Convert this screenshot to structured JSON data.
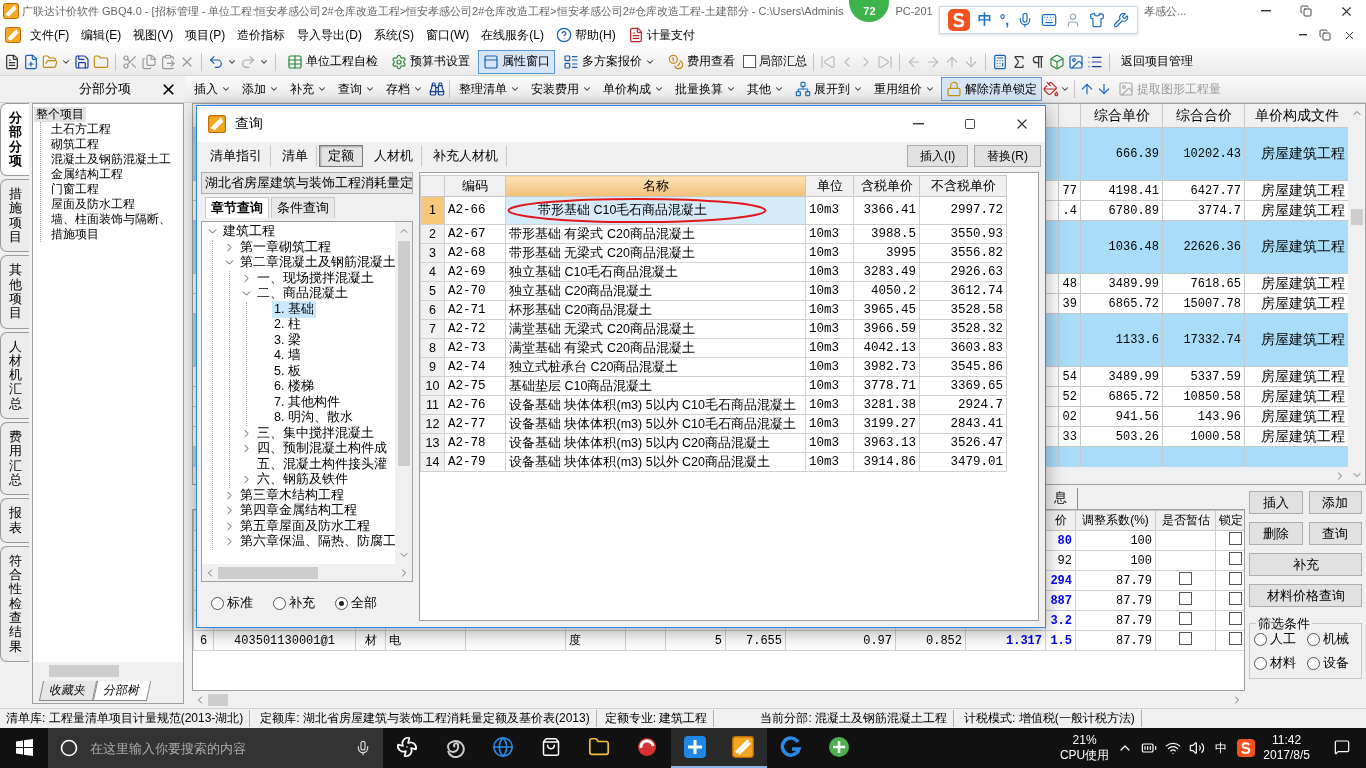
{
  "window": {
    "title": "广联达计价软件 GBQ4.0 - [招标管理 - 单位工程:恒安孝感公司2#仓库改造工程>恒安孝感公司2#仓库改造工程>恒安孝感公司2#仓库改造工程-土建部分 - C:\\Users\\Adminis",
    "badge": "72",
    "title_tail": "PC-201",
    "title_end": "孝感公..."
  },
  "ime": {
    "mode": "中",
    "punctuation": "°,"
  },
  "menu": [
    {
      "label": "文件(F)",
      "kind": "text"
    },
    {
      "label": "编辑(E)",
      "kind": "text"
    },
    {
      "label": "视图(V)",
      "kind": "text"
    },
    {
      "label": "项目(P)",
      "kind": "text"
    },
    {
      "label": "造价指标",
      "kind": "text"
    },
    {
      "label": "导入导出(D)",
      "kind": "text"
    },
    {
      "label": "系统(S)",
      "kind": "text"
    },
    {
      "label": "窗口(W)",
      "kind": "text"
    },
    {
      "label": "在线服务(L)",
      "kind": "text"
    },
    {
      "label": "帮助(H)",
      "kind": "help"
    },
    {
      "label": "计量支付",
      "kind": "pay"
    }
  ],
  "toolbar": {
    "tools": [
      {
        "label": "单位工程自检",
        "pressed": false,
        "menu": false
      },
      {
        "label": "预算书设置",
        "pressed": false,
        "menu": false
      },
      {
        "label": "属性窗口",
        "pressed": true,
        "menu": false
      },
      {
        "label": "多方案报价",
        "pressed": false,
        "menu": true
      },
      {
        "label": "费用查看",
        "pressed": false,
        "menu": false
      }
    ],
    "summary": {
      "label": "局部汇总",
      "checked": false
    },
    "back": "返回项目管理"
  },
  "panel": {
    "title": "分部分项"
  },
  "edit_toolbar": [
    [
      {
        "label": "插入",
        "menu": true,
        "kind": "text",
        "pressed": false,
        "disabled": false
      },
      {
        "label": "添加",
        "menu": true,
        "kind": "text",
        "pressed": false,
        "disabled": false
      },
      {
        "label": "补充",
        "menu": true,
        "kind": "text",
        "pressed": false,
        "disabled": false
      },
      {
        "label": "查询",
        "menu": true,
        "kind": "text",
        "pressed": false,
        "disabled": false
      },
      {
        "label": "存档",
        "menu": true,
        "kind": "text",
        "pressed": false,
        "disabled": false
      }
    ],
    [
      {
        "label": "整理清单",
        "menu": true,
        "kind": "text",
        "pressed": false,
        "disabled": false
      },
      {
        "label": "安装费用",
        "menu": true,
        "kind": "text",
        "pressed": false,
        "disabled": false
      },
      {
        "label": "单价构成",
        "menu": true,
        "kind": "text",
        "pressed": false,
        "disabled": false
      },
      {
        "label": "批量换算",
        "menu": true,
        "kind": "text",
        "pressed": false,
        "disabled": false
      },
      {
        "label": "其他",
        "menu": true,
        "kind": "text",
        "pressed": false,
        "disabled": false
      },
      {
        "label": "展开到",
        "menu": true,
        "kind": "expand",
        "pressed": false,
        "disabled": false
      },
      {
        "label": "重用组价",
        "menu": true,
        "kind": "text",
        "pressed": false,
        "disabled": false
      },
      {
        "label": "解除清单锁定",
        "menu": false,
        "kind": "lock",
        "pressed": true,
        "disabled": false
      }
    ],
    [
      {
        "label": "提取图形工程量",
        "menu": false,
        "kind": "extract",
        "pressed": false,
        "disabled": true
      }
    ]
  ],
  "side_tabs": [
    {
      "label": "分部分项",
      "selected": true
    },
    {
      "label": "措施项目",
      "selected": false
    },
    {
      "label": "其他项目",
      "selected": false
    },
    {
      "label": "人材机汇总",
      "selected": false
    },
    {
      "label": "费用汇总",
      "selected": false
    },
    {
      "label": "报表",
      "selected": false
    },
    {
      "label": "符合性检查结果",
      "selected": false
    }
  ],
  "project_tree": {
    "label": "整个项目",
    "selected": true,
    "children": [
      {
        "label": "土石方工程",
        "selected": false
      },
      {
        "label": "砌筑工程",
        "selected": false
      },
      {
        "label": "混凝土及钢筋混凝土工",
        "selected": false
      },
      {
        "label": "金属结构工程",
        "selected": false
      },
      {
        "label": "门窗工程",
        "selected": false
      },
      {
        "label": "屋面及防水工程",
        "selected": false
      },
      {
        "label": "墙、柱面装饰与隔断、",
        "selected": false
      },
      {
        "label": "措施项目",
        "selected": false
      }
    ]
  },
  "tree_tabs": [
    {
      "label": "收藏夹",
      "selected": false
    },
    {
      "label": "分部树",
      "selected": true
    }
  ],
  "main_grid": {
    "columns": [
      "综合单价",
      "综合合价",
      "单价构成文件"
    ],
    "rows": [
      {
        "kind": "group",
        "unit_price": "666.39",
        "total": "10202.43",
        "file": "房屋建筑工程"
      },
      {
        "kind": "item",
        "partial": "77",
        "unit_price": "4198.41",
        "total": "6427.77",
        "file": "房屋建筑工程"
      },
      {
        "kind": "item",
        "partial": ".4",
        "unit_price": "6780.89",
        "total": "3774.7",
        "file": "房屋建筑工程"
      },
      {
        "kind": "group",
        "unit_price": "1036.48",
        "total": "22626.36",
        "file": "房屋建筑工程"
      },
      {
        "kind": "item",
        "partial": "48",
        "unit_price": "3489.99",
        "total": "7618.65",
        "file": "房屋建筑工程"
      },
      {
        "kind": "item",
        "partial": "39",
        "unit_price": "6865.72",
        "total": "15007.78",
        "file": "房屋建筑工程"
      },
      {
        "kind": "group",
        "unit_price": "1133.6",
        "total": "17332.74",
        "file": "房屋建筑工程"
      },
      {
        "kind": "item",
        "partial": "54",
        "unit_price": "3489.99",
        "total": "5337.59",
        "file": "房屋建筑工程"
      },
      {
        "kind": "item",
        "partial": "52",
        "unit_price": "6865.72",
        "total": "10850.58",
        "file": "房屋建筑工程"
      },
      {
        "kind": "item",
        "partial": "02",
        "unit_price": "941.56",
        "total": "143.96",
        "file": "房屋建筑工程"
      },
      {
        "kind": "item",
        "partial": "33",
        "unit_price": "503.26",
        "total": "1000.58",
        "file": "房屋建筑工程"
      },
      {
        "kind": "group"
      }
    ]
  },
  "lower": {
    "tab": "息",
    "columns": [
      "价",
      "调整系数(%)",
      "是否暂估",
      "锁定"
    ],
    "rows": [
      {
        "price": "80",
        "changed": true,
        "ratio": "100",
        "locked": false
      },
      {
        "price": "92",
        "changed": false,
        "ratio": "100",
        "locked": false
      },
      {
        "price": "294",
        "changed": true,
        "ratio": "87.79",
        "estimate": false,
        "locked": false
      },
      {
        "price": "887",
        "changed": true,
        "ratio": "87.79",
        "estimate": false,
        "locked": false
      },
      {
        "price": "3.2",
        "changed": true,
        "ratio": "87.79",
        "estimate": false,
        "locked": false
      },
      {
        "no": "6",
        "code": "403501130001@1",
        "type": "材",
        "name": "电",
        "unit": "度",
        "quantity": "5",
        "column_9": "7.655",
        "column_10": "0.97",
        "column_11": "0.852",
        "column_12": "1.317",
        "price": "1.5",
        "changed": true,
        "ratio": "87.79",
        "estimate": false,
        "locked": false
      }
    ]
  },
  "side_buttons": [
    {
      "label": "插入",
      "wide": false
    },
    {
      "label": "添加",
      "wide": false
    },
    {
      "label": "删除",
      "wide": false
    },
    {
      "label": "查询",
      "wide": false
    },
    {
      "label": "补充",
      "wide": true
    },
    {
      "label": "材料价格查询",
      "wide": true
    }
  ],
  "filter": {
    "title": "筛选条件",
    "options": [
      {
        "label": "人工",
        "selected": false
      },
      {
        "label": "机械",
        "selected": false
      },
      {
        "label": "材料",
        "selected": false
      },
      {
        "label": "设备",
        "selected": false
      }
    ]
  },
  "status_bar": [
    "清单库: 工程量清单项目计量规范(2013-湖北)",
    "定额库: 湖北省房屋建筑与装饰工程消耗量定额及基价表(2013)",
    "定额专业: 建筑工程",
    "当前分部: 混凝土及钢筋混凝土工程",
    "计税模式: 增值税(一般计税方法)"
  ],
  "taskbar": {
    "placeholder": "在这里输入你要搜索的内容",
    "cpu": "21%",
    "cpu_label": "CPU使用",
    "ime": "中",
    "time": "11:42",
    "date": "2017/8/5"
  },
  "dialog": {
    "title": "查询",
    "tabs": [
      {
        "label": "清单指引",
        "selected": false
      },
      {
        "label": "清单",
        "selected": false
      },
      {
        "label": "定额",
        "selected": true
      },
      {
        "label": "人材机",
        "selected": false
      },
      {
        "label": "补充人材机",
        "selected": false
      }
    ],
    "actions": [
      "插入(I)",
      "替换(R)"
    ],
    "library": "湖北省房屋建筑与装饰工程消耗量定",
    "search_tabs": [
      {
        "label": "章节查询",
        "selected": true
      },
      {
        "label": "条件查询",
        "selected": false
      }
    ],
    "tree": [
      {
        "label": "建筑工程",
        "expanded": true,
        "selected": false,
        "children": [
          {
            "label": "第一章砌筑工程",
            "expanded": false,
            "selected": false
          },
          {
            "label": "第二章混凝土及钢筋混凝土",
            "expanded": true,
            "selected": false,
            "children": [
              {
                "label": "一、现场搅拌混凝土",
                "expanded": false,
                "selected": false
              },
              {
                "label": "二、商品混凝土",
                "expanded": true,
                "selected": false,
                "children": [
                  {
                    "label": "1. 基础",
                    "selected": true
                  },
                  {
                    "label": "2. 柱",
                    "selected": false
                  },
                  {
                    "label": "3. 梁",
                    "selected": false
                  },
                  {
                    "label": "4. 墙",
                    "selected": false
                  },
                  {
                    "label": "5. 板",
                    "selected": false
                  },
                  {
                    "label": "6. 楼梯",
                    "selected": false
                  },
                  {
                    "label": "7. 其他构件",
                    "selected": false
                  },
                  {
                    "label": "8. 明沟、散水",
                    "selected": false
                  }
                ]
              },
              {
                "label": "三、集中搅拌混凝土",
                "expanded": false,
                "selected": false
              },
              {
                "label": "四、预制混凝土构件成",
                "expanded": false,
                "selected": false
              },
              {
                "label": "五、混凝土构件接头灌",
                "selected": false
              },
              {
                "label": "六、钢筋及铁件",
                "expanded": false,
                "selected": false
              }
            ]
          },
          {
            "label": "第三章木结构工程",
            "expanded": false,
            "selected": false
          },
          {
            "label": "第四章金属结构工程",
            "expanded": false,
            "selected": false
          },
          {
            "label": "第五章屋面及防水工程",
            "expanded": false,
            "selected": false
          },
          {
            "label": "第六章保温、隔热、防腐工",
            "expanded": false,
            "selected": false
          }
        ]
      }
    ],
    "scope": [
      {
        "label": "标准",
        "selected": false
      },
      {
        "label": "补充",
        "selected": false
      },
      {
        "label": "全部",
        "selected": true
      }
    ],
    "table": {
      "columns": [
        {
          "label": "编码",
          "active": false
        },
        {
          "label": "名称",
          "active": true
        },
        {
          "label": "单位",
          "active": false
        },
        {
          "label": "含税单价",
          "active": false
        },
        {
          "label": "不含税单价",
          "active": false
        }
      ],
      "rows": [
        {
          "no": "1",
          "code": "A2-66",
          "name": "带形基础 C10毛石商品混凝土",
          "unit": "10m3",
          "price_tax": "3366.41",
          "price": "2997.72",
          "selected": true
        },
        {
          "no": "2",
          "code": "A2-67",
          "name": "带形基础 有梁式 C20商品混凝土",
          "unit": "10m3",
          "price_tax": "3988.5",
          "price": "3550.93",
          "selected": false
        },
        {
          "no": "3",
          "code": "A2-68",
          "name": "带形基础 无梁式 C20商品混凝土",
          "unit": "10m3",
          "price_tax": "3995",
          "price": "3556.82",
          "selected": false
        },
        {
          "no": "4",
          "code": "A2-69",
          "name": "独立基础 C10毛石商品混凝土",
          "unit": "10m3",
          "price_tax": "3283.49",
          "price": "2926.63",
          "selected": false
        },
        {
          "no": "5",
          "code": "A2-70",
          "name": "独立基础 C20商品混凝土",
          "unit": "10m3",
          "price_tax": "4050.2",
          "price": "3612.74",
          "selected": false
        },
        {
          "no": "6",
          "code": "A2-71",
          "name": "杯形基础 C20商品混凝土",
          "unit": "10m3",
          "price_tax": "3965.45",
          "price": "3528.58",
          "selected": false
        },
        {
          "no": "7",
          "code": "A2-72",
          "name": "满堂基础 无梁式 C20商品混凝土",
          "unit": "10m3",
          "price_tax": "3966.59",
          "price": "3528.32",
          "selected": false
        },
        {
          "no": "8",
          "code": "A2-73",
          "name": "满堂基础 有梁式 C20商品混凝土",
          "unit": "10m3",
          "price_tax": "4042.13",
          "price": "3603.83",
          "selected": false
        },
        {
          "no": "9",
          "code": "A2-74",
          "name": "独立式桩承台 C20商品混凝土",
          "unit": "10m3",
          "price_tax": "3982.73",
          "price": "3545.86",
          "selected": false
        },
        {
          "no": "10",
          "code": "A2-75",
          "name": "基础垫层 C10商品混凝土",
          "unit": "10m3",
          "price_tax": "3778.71",
          "price": "3369.65",
          "selected": false
        },
        {
          "no": "11",
          "code": "A2-76",
          "name": "设备基础 块体体积(m3) 5以内 C10毛石商品混凝土",
          "unit": "10m3",
          "price_tax": "3281.38",
          "price": "2924.7",
          "selected": false
        },
        {
          "no": "12",
          "code": "A2-77",
          "name": "设备基础 块体体积(m3) 5以外 C10毛石商品混凝土",
          "unit": "10m3",
          "price_tax": "3199.27",
          "price": "2843.41",
          "selected": false
        },
        {
          "no": "13",
          "code": "A2-78",
          "name": "设备基础 块体体积(m3) 5以内 C20商品混凝土",
          "unit": "10m3",
          "price_tax": "3963.13",
          "price": "3526.47",
          "selected": false
        },
        {
          "no": "14",
          "code": "A2-79",
          "name": "设备基础 块体体积(m3) 5以外 C20商品混凝土",
          "unit": "10m3",
          "price_tax": "3914.86",
          "price": "3479.01",
          "selected": false
        }
      ]
    }
  }
}
